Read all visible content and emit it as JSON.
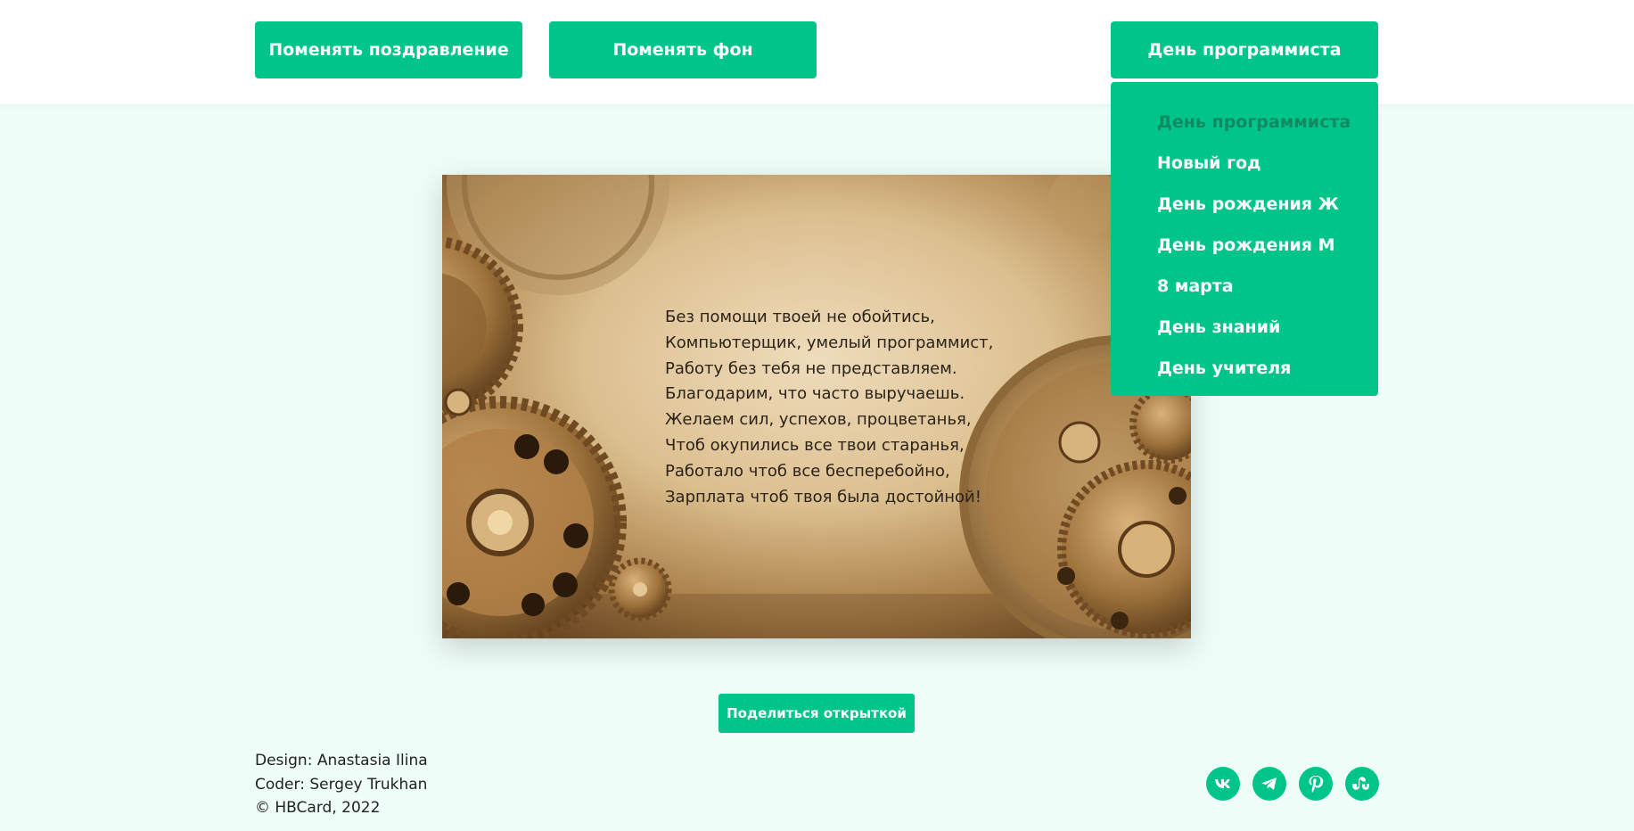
{
  "header": {
    "change_greeting": "Поменять поздравление",
    "change_background": "Поменять фон",
    "occasion_selected": "День программиста"
  },
  "dropdown": {
    "items": [
      "День программиста",
      "Новый год",
      "День рождения Ж",
      "День рождения М",
      "8 марта",
      "День знаний",
      "День учителя"
    ],
    "active_index": 0
  },
  "card": {
    "lines": [
      "Без помощи твоей не обойтись,",
      "Компьютерщик, умелый программист,",
      "Работу без тебя не представляем.",
      "Благодарим, что часто выручаешь.",
      "Желаем сил, успехов, процветанья,",
      "Чтоб окупились все твои старанья,",
      "Работало чтоб все бесперебойно,",
      "Зарплата чтоб твоя была достойной!"
    ]
  },
  "share_button": "Поделиться открыткой",
  "footer": {
    "design": "Design: Anastasia Ilina",
    "coder": "Coder: Sergey Trukhan",
    "copyright": "© HBCard, 2022"
  },
  "social_icons": [
    "vk-icon",
    "telegram-icon",
    "pinterest-icon",
    "stumbleupon-icon"
  ],
  "colors": {
    "accent": "#00c58a",
    "page_background": "#effdf9",
    "active_item": "#0f8a63"
  }
}
